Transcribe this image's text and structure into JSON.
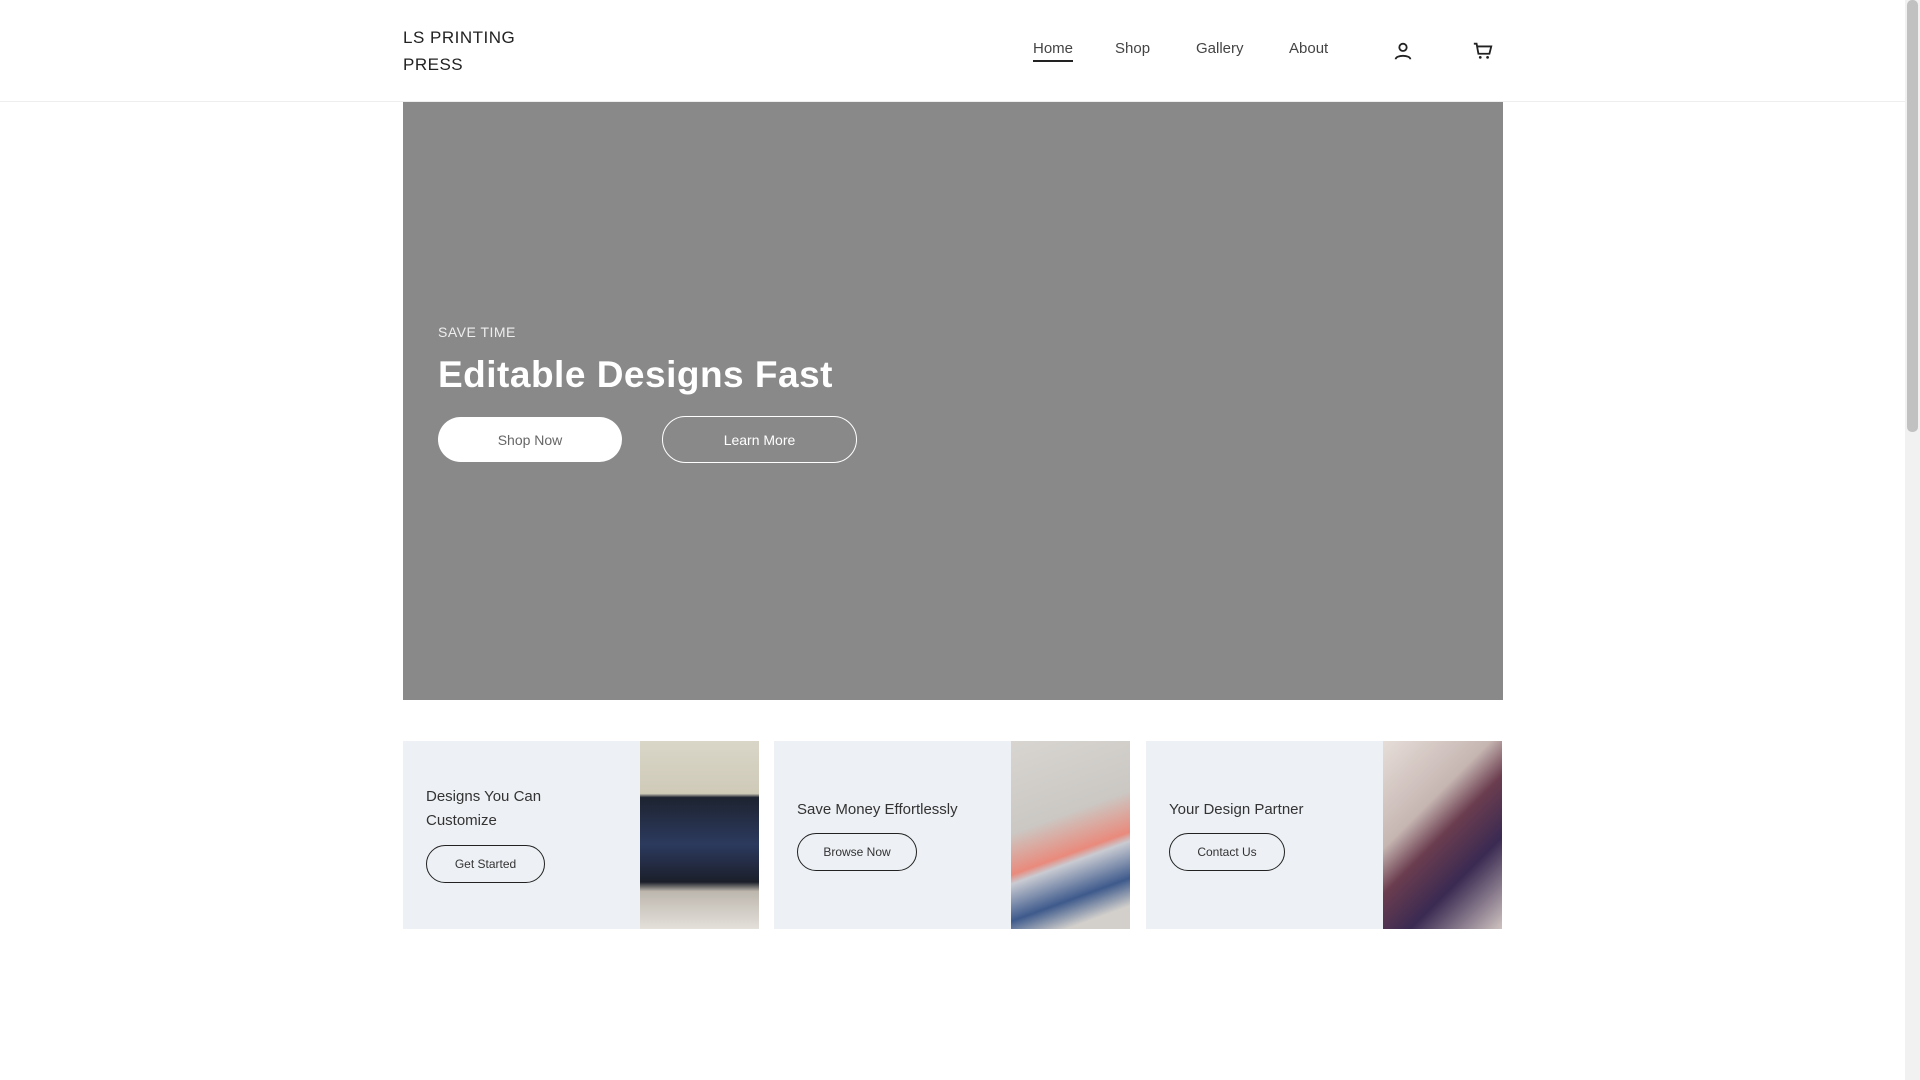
{
  "header": {
    "logo": "LS PRINTING PRESS",
    "nav": [
      "Home",
      "Shop",
      "Gallery",
      "About"
    ],
    "active": "Home"
  },
  "hero": {
    "eyebrow": "SAVE TIME",
    "title": "Editable Designs Fast",
    "primary_button": "Shop Now",
    "secondary_button": "Learn More"
  },
  "cards": [
    {
      "text": "Designs You Can Customize",
      "button": "Get Started"
    },
    {
      "text": "Save Money Effortlessly",
      "button": "Browse Now"
    },
    {
      "text": "Your Design Partner",
      "button": "Contact Us"
    }
  ]
}
